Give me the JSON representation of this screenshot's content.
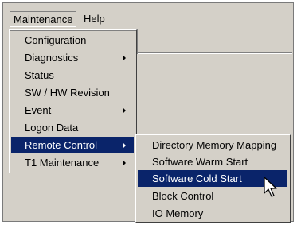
{
  "menubar": {
    "maintenance": "Maintenance",
    "help": "Help"
  },
  "maintenance_menu": {
    "items": [
      {
        "label": "Configuration"
      },
      {
        "label": "Diagnostics"
      },
      {
        "label": "Status"
      },
      {
        "label": "SW / HW Revision"
      },
      {
        "label": "Event"
      },
      {
        "label": "Logon Data"
      },
      {
        "label": "Remote Control"
      },
      {
        "label": "T1 Maintenance"
      }
    ]
  },
  "remote_control_menu": {
    "items": [
      {
        "label": "Directory Memory Mapping"
      },
      {
        "label": "Software Warm Start"
      },
      {
        "label": "Software Cold Start"
      },
      {
        "label": "Block Control"
      },
      {
        "label": "IO Memory"
      }
    ]
  },
  "colors": {
    "menu_bg": "#d4d0c8",
    "highlight": "#0a246a",
    "highlight_text": "#ffffff"
  }
}
